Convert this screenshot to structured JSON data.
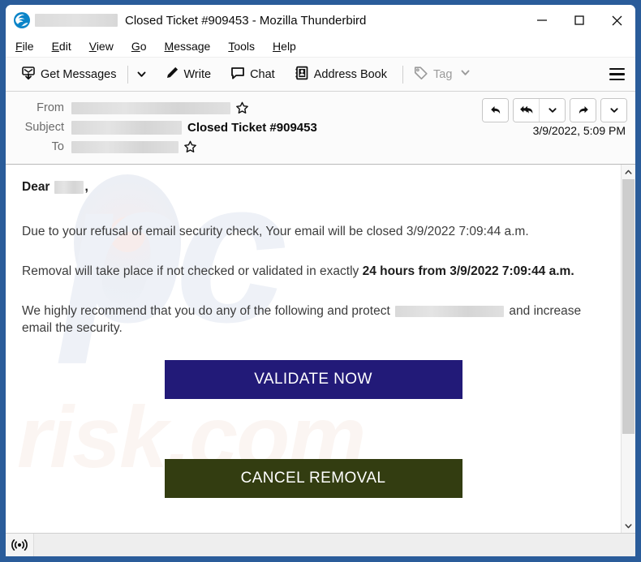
{
  "window": {
    "title": "Closed Ticket #909453 - Mozilla Thunderbird",
    "logo_icon": "thunderbird-logo-icon",
    "redacted_prefix": "",
    "controls": {
      "minimize_icon": "minimize-icon",
      "maximize_icon": "maximize-icon",
      "close_icon": "close-icon"
    },
    "border_color": "#2a5c9a"
  },
  "menubar": {
    "items": [
      {
        "label": "File",
        "accesskey": "F"
      },
      {
        "label": "Edit",
        "accesskey": "E"
      },
      {
        "label": "View",
        "accesskey": "V"
      },
      {
        "label": "Go",
        "accesskey": "G"
      },
      {
        "label": "Message",
        "accesskey": "M"
      },
      {
        "label": "Tools",
        "accesskey": "T"
      },
      {
        "label": "Help",
        "accesskey": "H"
      }
    ]
  },
  "toolbar": {
    "get_messages_label": "Get Messages",
    "get_messages_icon": "download-mail-icon",
    "get_messages_caret_icon": "chevron-down-icon",
    "write_label": "Write",
    "write_icon": "pencil-icon",
    "chat_label": "Chat",
    "chat_icon": "speech-bubble-icon",
    "address_book_label": "Address Book",
    "address_book_icon": "address-book-icon",
    "tag_label": "Tag",
    "tag_icon": "tag-icon",
    "tag_caret_icon": "chevron-down-icon",
    "tag_disabled": true,
    "app_menu_icon": "hamburger-menu-icon"
  },
  "message_header": {
    "from_label": "From",
    "from_value": "",
    "from_star_icon": "star-outline-icon",
    "subject_label": "Subject",
    "subject_redacted": "",
    "subject_value": "Closed Ticket #909453",
    "to_label": "To",
    "to_value": "",
    "to_star_icon": "star-outline-icon",
    "date": "3/9/2022, 5:09 PM",
    "actions": {
      "reply_icon": "reply-icon",
      "reply_all_icon": "reply-all-icon",
      "reply_all_caret_icon": "chevron-down-icon",
      "forward_icon": "forward-icon",
      "forward_caret_icon": "chevron-down-icon"
    }
  },
  "message_body": {
    "greeting_prefix": "Dear",
    "greeting_name_redacted": "",
    "greeting_suffix": ",",
    "paragraph_1": "Due to your refusal of email security check, Your email will be closed 3/9/2022 7:09:44 a.m.",
    "paragraph_2_prefix": "Removal will take place if not checked or validated in exactly ",
    "paragraph_2_bold": "24 hours from 3/9/2022 7:09:44 a.m.",
    "paragraph_3_prefix": "We highly recommend that you do any of the following and protect ",
    "paragraph_3_redacted": "",
    "paragraph_3_suffix": " and increase email the security.",
    "validate_button_label": "VALIDATE NOW",
    "validate_button_color": "#221a78",
    "cancel_button_label": "CANCEL REMOVAL",
    "cancel_button_color": "#333d11",
    "watermark_primary": "pc",
    "watermark_secondary": "risk.com"
  },
  "scrollbar": {
    "up_arrow_icon": "chevron-up-icon",
    "down_arrow_icon": "chevron-down-icon",
    "thumb_position_percent": 0,
    "thumb_size_percent": 75
  },
  "statusbar": {
    "connection_icon": "broadcast-icon",
    "status_text": ""
  }
}
